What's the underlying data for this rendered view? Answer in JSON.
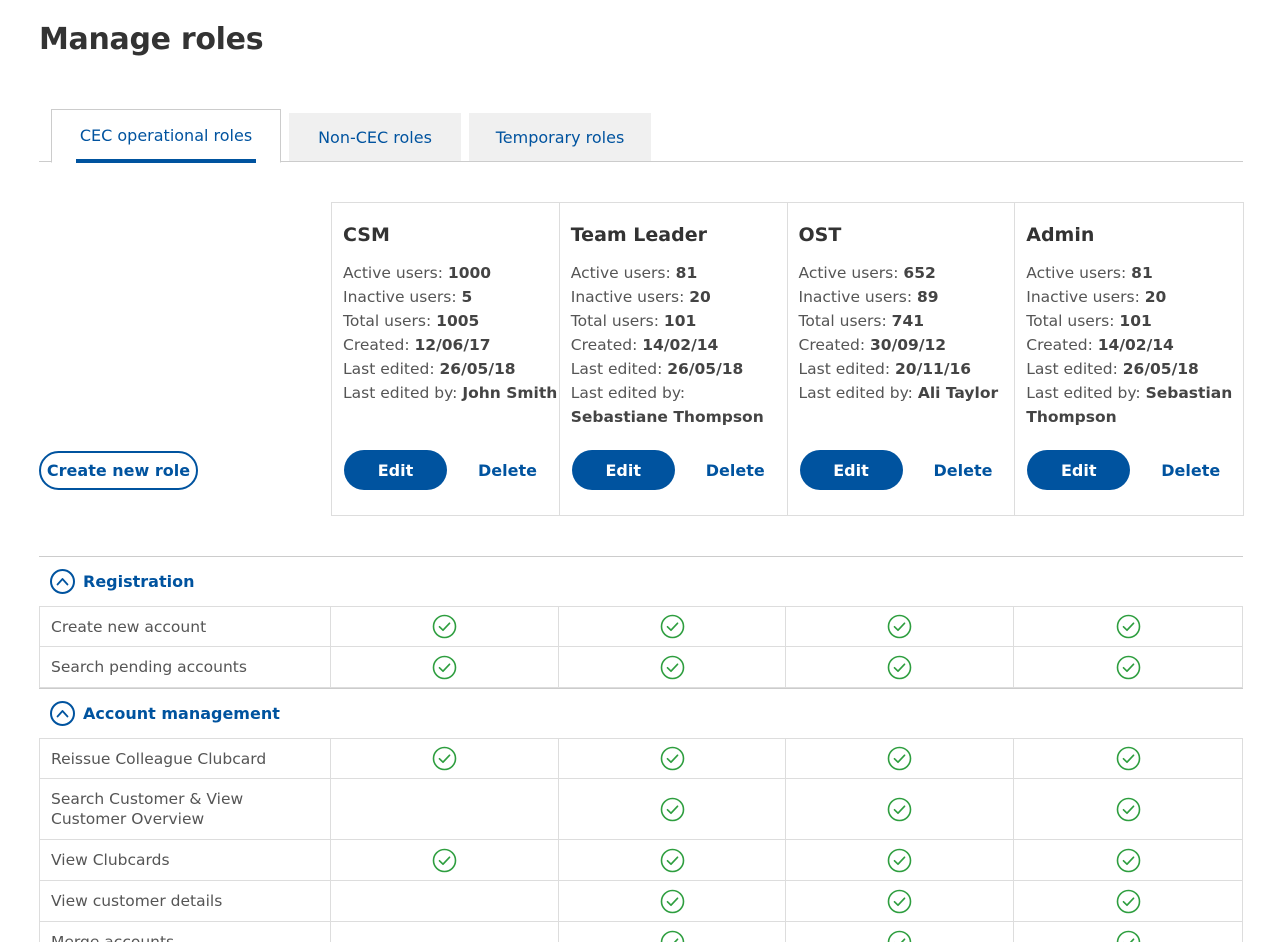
{
  "page": {
    "title": "Manage roles"
  },
  "tabs": [
    {
      "label": "CEC operational roles",
      "active": true
    },
    {
      "label": "Non-CEC roles",
      "active": false
    },
    {
      "label": "Temporary roles",
      "active": false
    }
  ],
  "create_button": "Create new role",
  "roles": [
    {
      "name": "CSM",
      "active_label": "Active users:",
      "active": "1000",
      "inactive_label": "Inactive users:",
      "inactive": "5",
      "total_label": "Total users:",
      "total": "1005",
      "created_label": "Created:",
      "created": "12/06/17",
      "edited_label": "Last edited:",
      "edited": "26/05/18",
      "edited_by_label": "Last edited by:",
      "edited_by": "John Smith",
      "edit": "Edit",
      "delete": "Delete"
    },
    {
      "name": "Team Leader",
      "active_label": "Active users:",
      "active": "81",
      "inactive_label": "Inactive users:",
      "inactive": "20",
      "total_label": "Total users:",
      "total": "101",
      "created_label": "Created:",
      "created": "14/02/14",
      "edited_label": "Last edited:",
      "edited": "26/05/18",
      "edited_by_label": "Last edited by:",
      "edited_by": "Sebastiane Thompson",
      "edit": "Edit",
      "delete": "Delete"
    },
    {
      "name": "OST",
      "active_label": "Active users:",
      "active": "652",
      "inactive_label": "Inactive users:",
      "inactive": "89",
      "total_label": "Total users:",
      "total": "741",
      "created_label": "Created:",
      "created": "30/09/12",
      "edited_label": "Last edited:",
      "edited": "20/11/16",
      "edited_by_label": "Last edited by:",
      "edited_by": "Ali Taylor",
      "edit": "Edit",
      "delete": "Delete"
    },
    {
      "name": "Admin",
      "active_label": "Active users:",
      "active": "81",
      "inactive_label": "Inactive users:",
      "inactive": "20",
      "total_label": "Total users:",
      "total": "101",
      "created_label": "Created:",
      "created": "14/02/14",
      "edited_label": "Last edited:",
      "edited": "26/05/18",
      "edited_by_label": "Last edited by:",
      "edited_by": "Sebastian Thompson",
      "edit": "Edit",
      "delete": "Delete"
    }
  ],
  "sections": [
    {
      "title": "Registration",
      "icon": "chevron-up-circle-icon",
      "rows": [
        {
          "label": "Create new account",
          "checks": [
            true,
            true,
            true,
            true
          ]
        },
        {
          "label": "Search pending accounts",
          "checks": [
            true,
            true,
            true,
            true
          ]
        }
      ]
    },
    {
      "title": "Account management",
      "icon": "chevron-up-circle-icon",
      "rows": [
        {
          "label": "Reissue Colleague Clubcard",
          "checks": [
            true,
            true,
            true,
            true
          ]
        },
        {
          "label": "Search Customer & View Customer Overview",
          "checks": [
            false,
            true,
            true,
            true
          ],
          "tall": true
        },
        {
          "label": "View Clubcards",
          "checks": [
            true,
            true,
            true,
            true
          ]
        },
        {
          "label": "View customer details",
          "checks": [
            false,
            true,
            true,
            true
          ]
        },
        {
          "label": "Merge accounts",
          "checks": [
            false,
            true,
            true,
            true
          ]
        }
      ]
    }
  ],
  "colors": {
    "brand_blue": "#00539f",
    "check_green": "#2e9e3f",
    "tab_inactive_bg": "#f0f0f0"
  }
}
